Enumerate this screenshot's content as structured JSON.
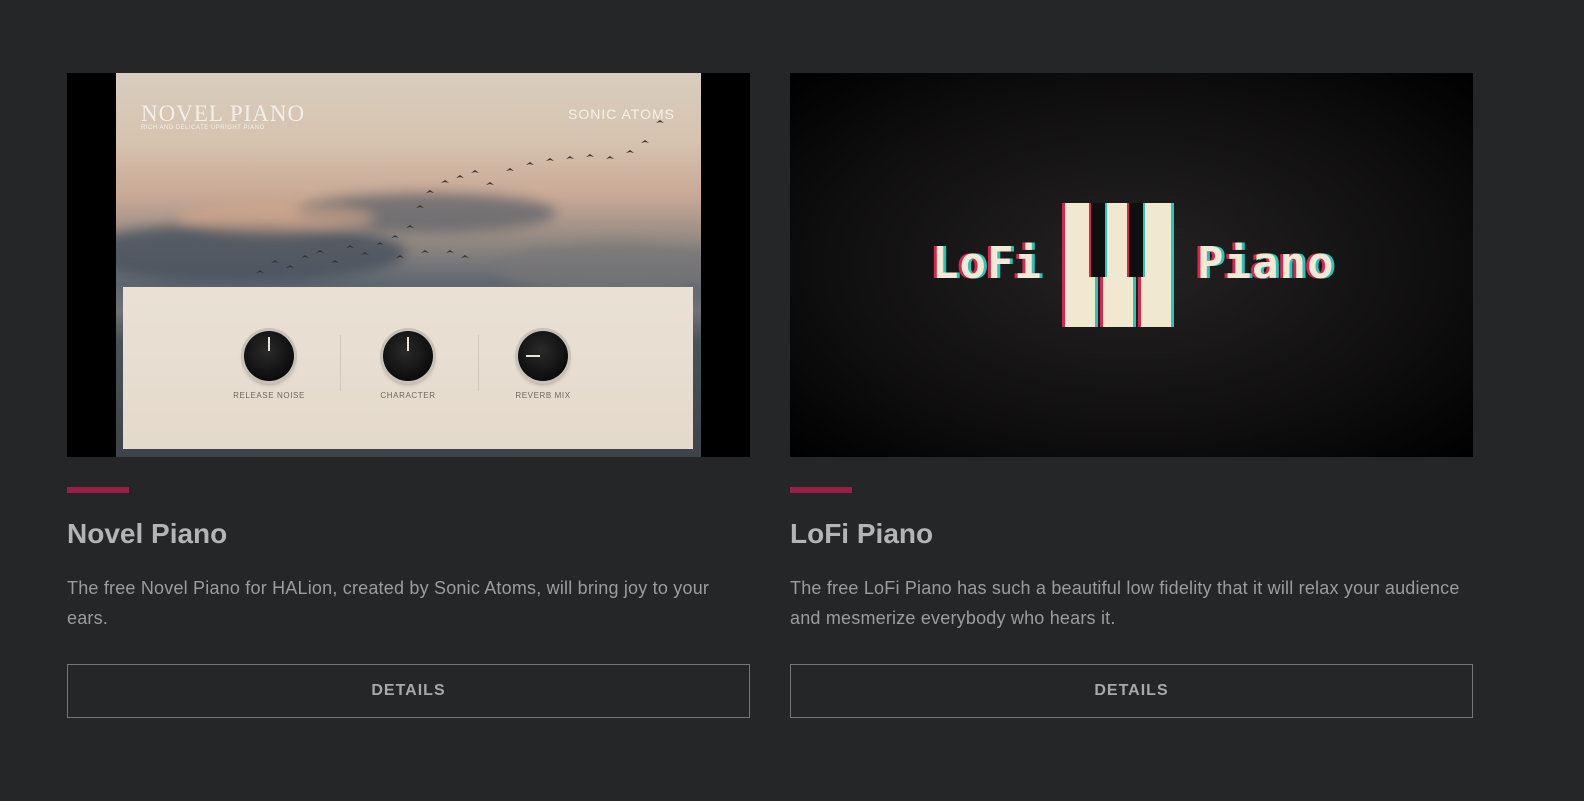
{
  "theme": {
    "background": "#252628",
    "accent": "#9b1e46"
  },
  "cards": [
    {
      "title": "Novel Piano",
      "description": "The free Novel Piano for HALion, created by Sonic Atoms, will bring joy to your ears.",
      "button_label": "DETAILS",
      "artwork": {
        "product_name": "NOVEL PIANO",
        "tagline": "RICH AND DELICATE UPRIGHT PIANO",
        "brand": "SONIC ATOMS",
        "knobs": [
          {
            "label": "RELEASE NOISE",
            "value": 0.5
          },
          {
            "label": "CHARACTER",
            "value": 0.5
          },
          {
            "label": "REVERB MIX",
            "value": 0.25
          }
        ]
      }
    },
    {
      "title": "LoFi Piano",
      "description": "The free LoFi Piano has such a beautiful low fidelity that it will relax your audience and mesmerize everybody who hears it.",
      "button_label": "DETAILS",
      "artwork": {
        "word_left": "LoFi",
        "word_right": "Piano"
      }
    }
  ]
}
